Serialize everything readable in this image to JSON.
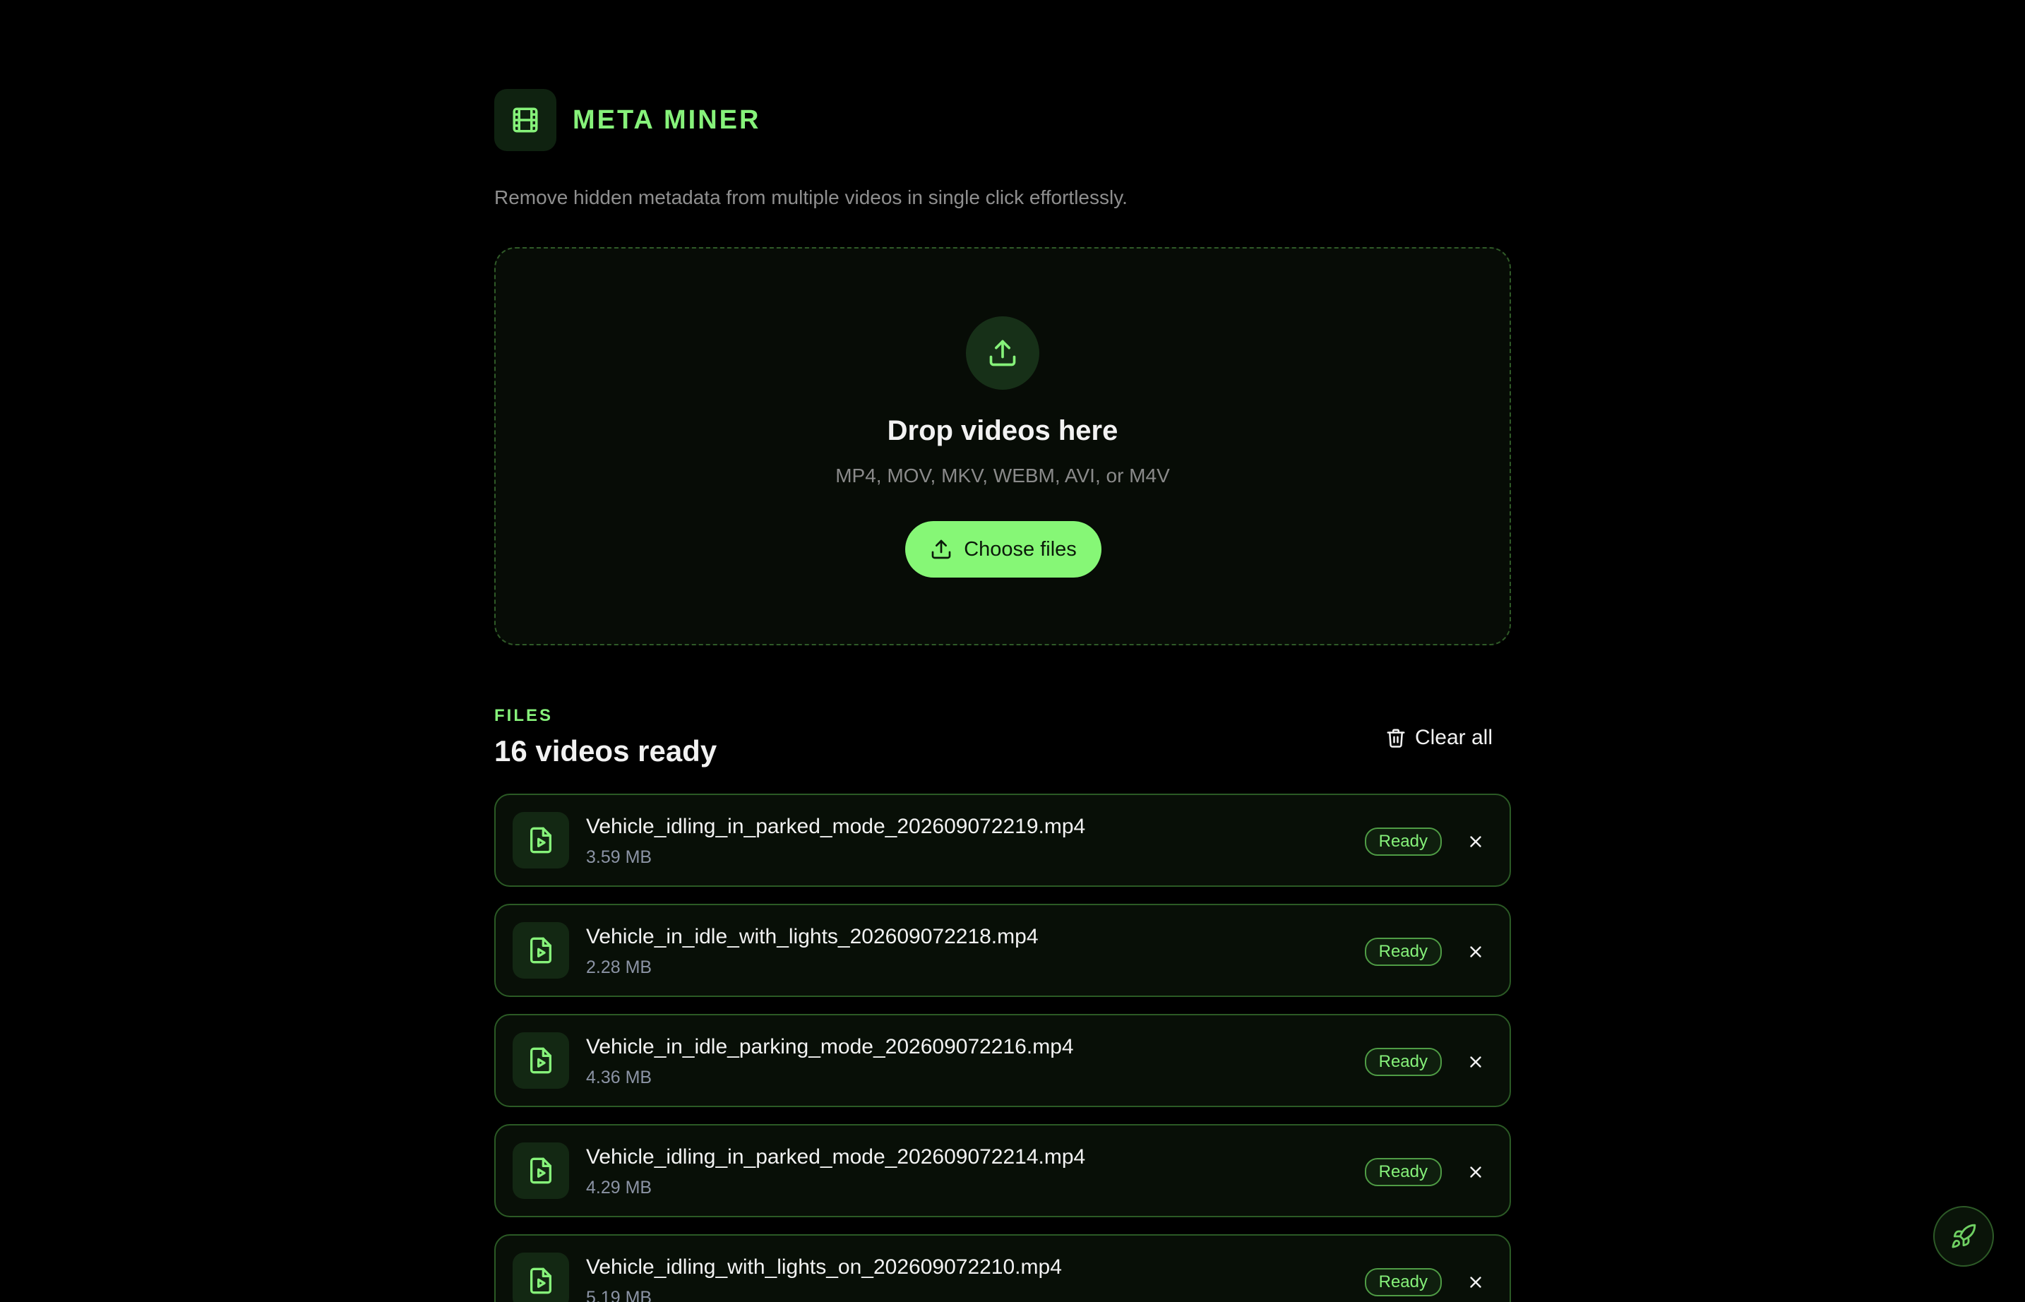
{
  "app": {
    "title": "META MINER",
    "tagline": "Remove hidden metadata from multiple videos in single click effortlessly.",
    "accent_color": "#86f27a",
    "logo_icon": "film-icon"
  },
  "dropzone": {
    "icon": "upload-icon",
    "title": "Drop videos here",
    "formats": "MP4, MOV, MKV, WEBM, AVI, or M4V",
    "choose_label": "Choose files"
  },
  "files": {
    "section_label": "FILES",
    "count_text": "16 videos ready",
    "clear_label": "Clear all",
    "items": [
      {
        "name": "Vehicle_idling_in_parked_mode_202609072219.mp4",
        "size": "3.59 MB",
        "status": "Ready"
      },
      {
        "name": "Vehicle_in_idle_with_lights_202609072218.mp4",
        "size": "2.28 MB",
        "status": "Ready"
      },
      {
        "name": "Vehicle_in_idle_parking_mode_202609072216.mp4",
        "size": "4.36 MB",
        "status": "Ready"
      },
      {
        "name": "Vehicle_idling_in_parked_mode_202609072214.mp4",
        "size": "4.29 MB",
        "status": "Ready"
      },
      {
        "name": "Vehicle_idling_with_lights_on_202609072210.mp4",
        "size": "5.19 MB",
        "status": "Ready"
      }
    ]
  },
  "fab": {
    "icon": "rocket-icon"
  }
}
